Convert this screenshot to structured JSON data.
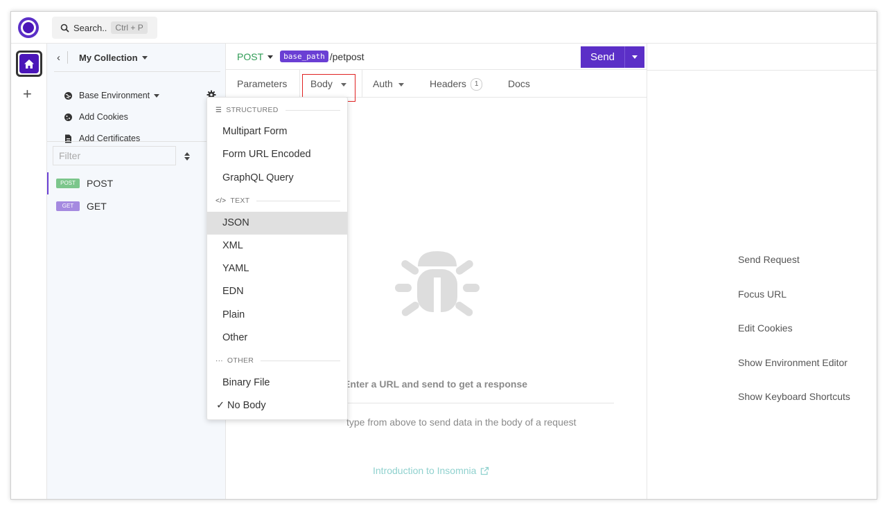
{
  "search": {
    "label": "Search..",
    "shortcut": "Ctrl + P"
  },
  "sidebar": {
    "collection_name": "My Collection",
    "environment": "Base Environment",
    "add_cookies": "Add Cookies",
    "add_certificates": "Add Certificates",
    "filter_placeholder": "Filter",
    "requests": [
      {
        "method": "POST",
        "name": "POST",
        "color": "#7cc68c"
      },
      {
        "method": "GET",
        "name": "GET",
        "color": "#a58ae0"
      }
    ]
  },
  "request": {
    "method": "POST",
    "base_path": "base_path",
    "path": "/petpost",
    "send_label": "Send"
  },
  "tabs": {
    "parameters": "Parameters",
    "body": "Body",
    "auth": "Auth",
    "headers": "Headers",
    "headers_count": "1",
    "docs": "Docs"
  },
  "body_menu": {
    "section_structured": "STRUCTURED",
    "structured": [
      "Multipart Form",
      "Form URL Encoded",
      "GraphQL Query"
    ],
    "section_text": "TEXT",
    "text": [
      "JSON",
      "XML",
      "YAML",
      "EDN",
      "Plain",
      "Other"
    ],
    "section_other": "OTHER",
    "other": [
      "Binary File",
      "No Body"
    ],
    "highlighted": "JSON",
    "checked": "No Body"
  },
  "empty_state": {
    "title": "Enter a URL and send to get a response",
    "subtitle": "type from above to send data in the body of a request",
    "link": "Introduction to Insomnia"
  },
  "shortcuts": [
    "Send Request",
    "Focus URL",
    "Edit Cookies",
    "Show Environment Editor",
    "Show Keyboard Shortcuts"
  ],
  "colors": {
    "accent": "#5b2fc7",
    "post": "#2e9b54",
    "outline": "#e02020"
  }
}
